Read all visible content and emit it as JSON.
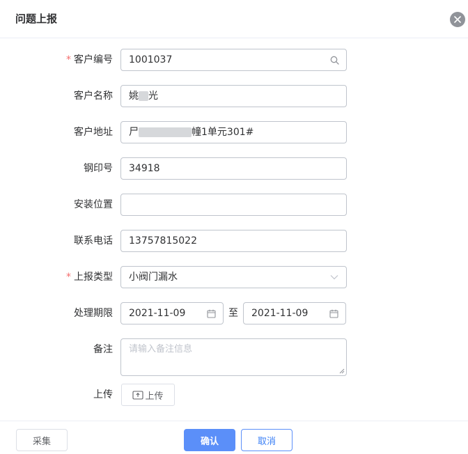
{
  "dialog": {
    "title": "问题上报"
  },
  "form": {
    "customer_no": {
      "label": "客户编号",
      "value": "1001037"
    },
    "customer_name": {
      "label": "客户名称",
      "value_prefix": "姚",
      "value_suffix": "光"
    },
    "customer_address": {
      "label": "客户地址",
      "value_prefix": "尸",
      "value_suffix": "幢1单元301#"
    },
    "seal_no": {
      "label": "钢印号",
      "value": "34918"
    },
    "install_location": {
      "label": "安装位置",
      "value": ""
    },
    "phone": {
      "label": "联系电话",
      "value": "13757815022"
    },
    "report_type": {
      "label": "上报类型",
      "value": "小阀门漏水"
    },
    "deadline": {
      "label": "处理期限",
      "start": "2021-11-09",
      "separator": "至",
      "end": "2021-11-09"
    },
    "remark": {
      "label": "备注",
      "placeholder": "请输入备注信息"
    },
    "upload": {
      "label": "上传",
      "button": "上传"
    }
  },
  "footer": {
    "collect": "采集",
    "confirm": "确认",
    "cancel": "取消"
  },
  "colors": {
    "primary": "#5b8ff9",
    "required": "#f56c6c"
  }
}
